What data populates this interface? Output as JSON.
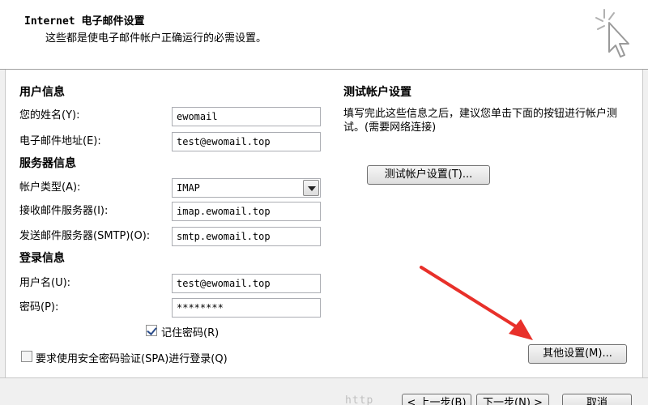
{
  "header": {
    "title": "Internet 电子邮件设置",
    "subtitle": "这些都是使电子邮件帐户正确运行的必需设置。",
    "icon": "cursor-sparkle-icon"
  },
  "user_info": {
    "title": "用户信息",
    "name_label": "您的姓名(Y):",
    "name_value": "ewomail",
    "email_label": "电子邮件地址(E):",
    "email_value": "test@ewomail.top"
  },
  "server_info": {
    "title": "服务器信息",
    "account_type_label": "帐户类型(A):",
    "account_type_value": "IMAP",
    "incoming_label": "接收邮件服务器(I):",
    "incoming_value": "imap.ewomail.top",
    "outgoing_label": "发送邮件服务器(SMTP)(O):",
    "outgoing_value": "smtp.ewomail.top"
  },
  "login_info": {
    "title": "登录信息",
    "username_label": "用户名(U):",
    "username_value": "test@ewomail.top",
    "password_label": "密码(P):",
    "password_value": "********",
    "remember_label": "记住密码(R)",
    "remember_checked": true,
    "spa_label": "要求使用安全密码验证(SPA)进行登录(Q)",
    "spa_checked": false
  },
  "test_settings": {
    "title": "测试帐户设置",
    "description": "填写完此这些信息之后，建议您单击下面的按钮进行帐户测试。(需要网络连接)",
    "test_button": "测试帐户设置(T)...",
    "more_button": "其他设置(M)..."
  },
  "footer": {
    "back_button": "< 上一步(B)",
    "next_button": "下一步(N) >",
    "cancel_button": "取消",
    "watermark": "http"
  },
  "colors": {
    "arrow": "#e8302a"
  }
}
